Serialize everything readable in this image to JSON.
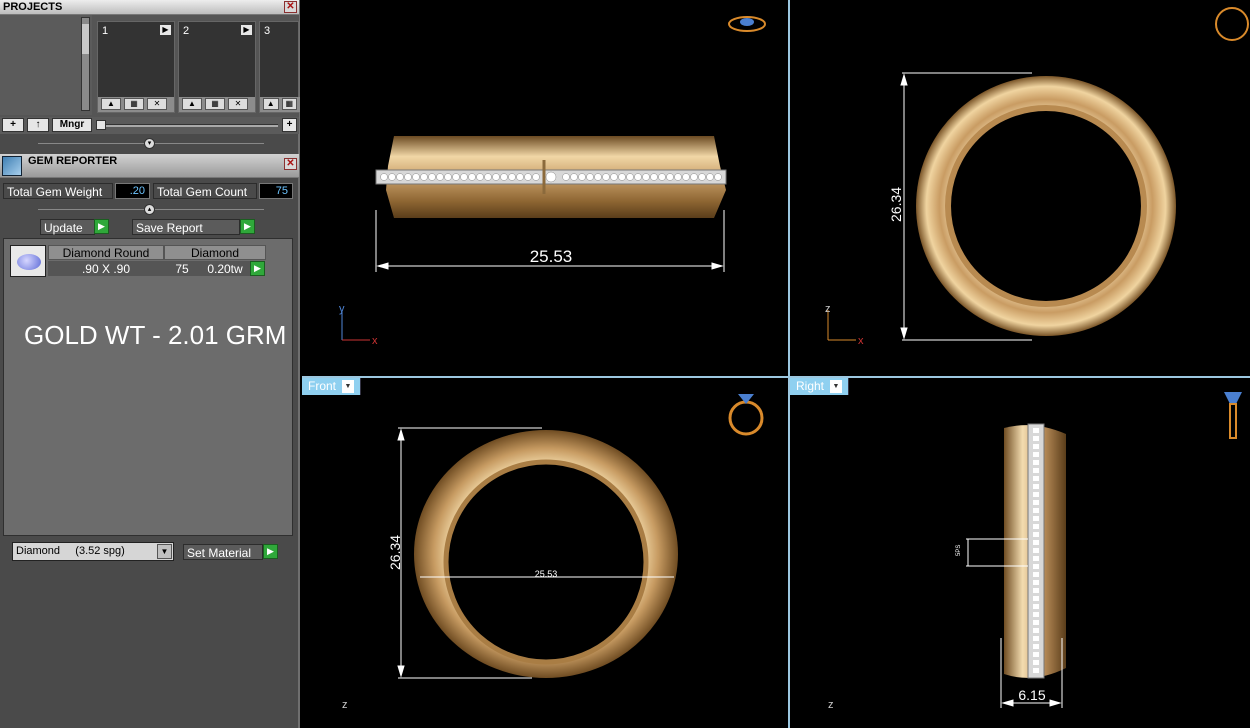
{
  "projects": {
    "title": "PROJECTS",
    "slots": [
      "1",
      "2",
      "3"
    ],
    "toolbar": {
      "add": "+",
      "up": "↑",
      "manager": "Mngr",
      "plus": "+"
    }
  },
  "gem_reporter": {
    "title": "GEM REPORTER",
    "total_weight_label": "Total Gem Weight",
    "total_weight_value": ".20",
    "total_count_label": "Total Gem Count",
    "total_count_value": "75",
    "update_label": "Update",
    "save_report_label": "Save Report",
    "row": {
      "shape": "Diamond Round",
      "material": "Diamond",
      "size": ".90 X .90",
      "count": "75",
      "weight": "0.20tw"
    },
    "annotation": "GOLD WT - 2.01 GRM",
    "material_select": "Diamond     (3.52 spg)",
    "set_material_label": "Set Material"
  },
  "viewports": {
    "top": {
      "dimension_width": "25.53",
      "axis_v": "y",
      "axis_h": "x"
    },
    "perspective": {
      "dimension_height": "26.34",
      "axis_v": "z",
      "axis_h": "x"
    },
    "front": {
      "tab": "Front",
      "dimension_height": "26.34",
      "dimension_width": "25.53",
      "axis_v": "z"
    },
    "right": {
      "tab": "Right",
      "dimension_width": "6.15",
      "dimension_small": "5PS",
      "axis_v": "z"
    }
  },
  "colors": {
    "gold": "#c9a06a",
    "accent_blue": "#8fd0f0",
    "play_green": "#2fa83a"
  }
}
